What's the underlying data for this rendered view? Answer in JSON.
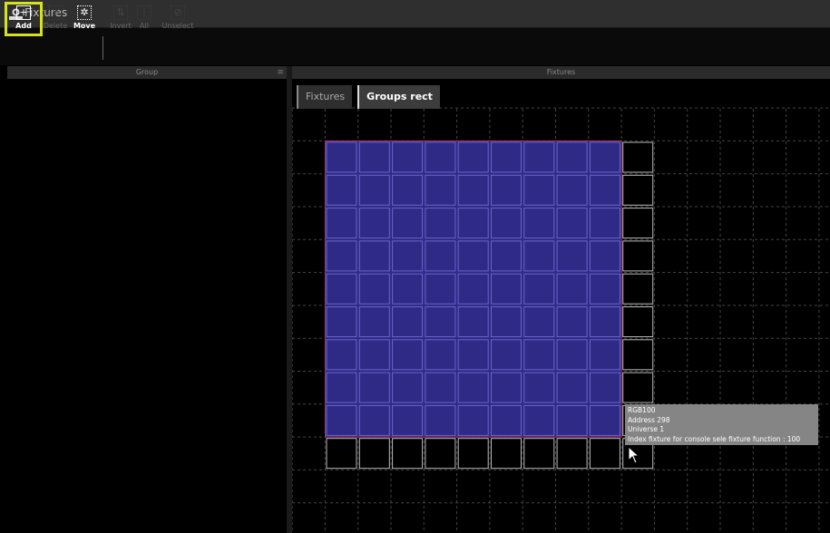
{
  "window": {
    "title": "Fixtures",
    "icon": "fixtures-icon"
  },
  "toolbar": {
    "add_label": "Add",
    "delete_label": "Delete",
    "move_label": "Move",
    "invert_label": "Invert",
    "all_label": "All",
    "unselect_label": "Unselect"
  },
  "left_panel": {
    "header": "Group",
    "menu_icon": "menu-icon"
  },
  "right_panel": {
    "header": "Fixtures"
  },
  "tabs": [
    {
      "label": "Fixtures",
      "active": false
    },
    {
      "label": "Groups rect",
      "active": true
    }
  ],
  "grid": {
    "columns": 10,
    "rows": 10,
    "selected_columns": 9,
    "selected_rows": 9,
    "selected_color": "#2e2a86",
    "selection_border_color": "#b03060"
  },
  "tooltip": {
    "line1": "RGB100",
    "line2": "Address 298",
    "line3": "Universe 1",
    "line4": "Index fixture for console sele fixture function : 100"
  },
  "colors": {
    "accent_highlight": "#d7e21a",
    "background": "#000000"
  }
}
